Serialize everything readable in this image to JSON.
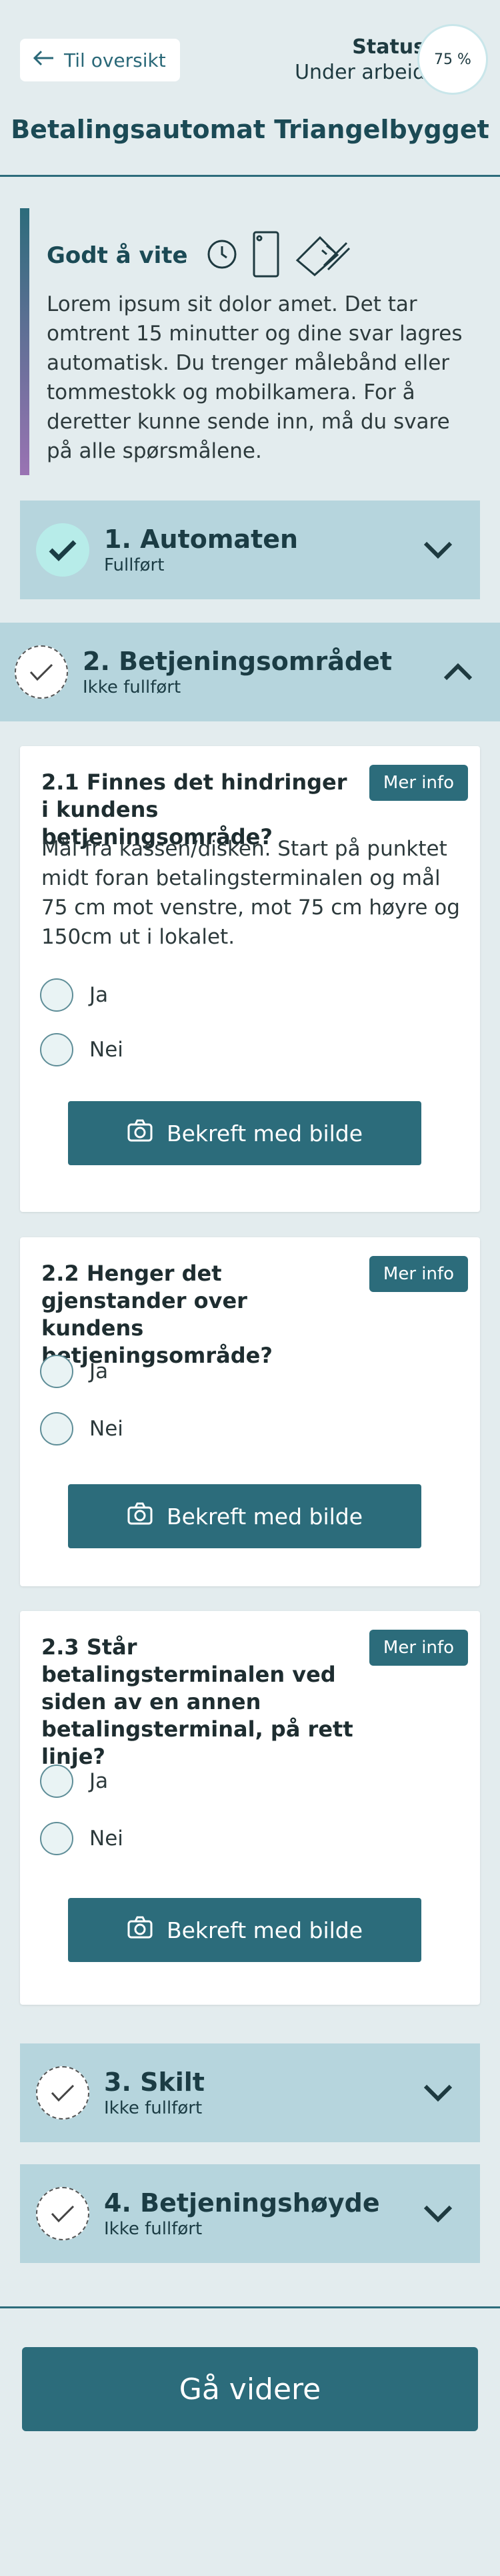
{
  "header": {
    "back_label": "Til oversikt",
    "status_title": "Status",
    "status_value": "Under arbeid",
    "progress_label": "75 %",
    "progress_value": 0.75,
    "page_title": "Betalingsautomat Triangelbygget"
  },
  "info": {
    "title": "Godt å vite",
    "icons": [
      "clock-icon",
      "phone-icon",
      "ruler-icon"
    ],
    "text": "Lorem ipsum sit dolor amet. Det tar omtrent 15 minutter og dine svar lagres automatisk. Du trenger målebånd eller tommestokk og mobilkamera. For å deretter kunne sende inn, må du svare på alle spørsmålene."
  },
  "sections": [
    {
      "title": "1. Automaten",
      "status": "Fullført"
    },
    {
      "title": "2. Betjeningsområdet",
      "status": "Ikke fullført"
    },
    {
      "title": "3. Skilt",
      "status": "Ikke fullført"
    },
    {
      "title": "4. Betjeningshøyde",
      "status": "Ikke fullført"
    }
  ],
  "questions": [
    {
      "title": "2.1 Finnes det hindringer i kundens betjeningsområde?",
      "more": "Mer info",
      "description": "Mål fra kassen/disken. Start på punktet midt foran betalingsterminalen og mål 75 cm mot venstre, mot 75 cm høyre og 150cm ut i lokalet.",
      "options": [
        "Ja",
        "Nei"
      ],
      "button": "Bekreft med bilde"
    },
    {
      "title": "2.2 Henger det gjenstander over kundens betjeningsområde?",
      "more": "Mer info",
      "options": [
        "Ja",
        "Nei"
      ],
      "button": "Bekreft med bilde"
    },
    {
      "title": "2.3 Står betalingsterminalen ved siden av en annen betalingsterminal, på rett linje?",
      "more": "Mer info",
      "options": [
        "Ja",
        "Nei"
      ],
      "button": "Bekreft med bilde"
    }
  ],
  "footer": {
    "next_label": "Gå videre"
  },
  "colors": {
    "accent": "#2c6c7b",
    "section_bg": "#b6d5dd",
    "page_bg": "#e3ecee",
    "done_circle": "#b7ece9"
  }
}
